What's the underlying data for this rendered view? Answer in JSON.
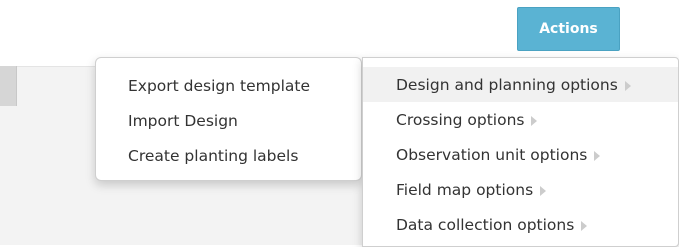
{
  "header": {
    "actions_label": "Actions"
  },
  "left_menu": {
    "items": [
      {
        "label": "Export design template"
      },
      {
        "label": "Import Design"
      },
      {
        "label": "Create planting labels"
      }
    ]
  },
  "right_menu": {
    "items": [
      {
        "label": "Design and planning options",
        "has_submenu": true,
        "active": true
      },
      {
        "label": "Crossing options",
        "has_submenu": true
      },
      {
        "label": "Observation unit options",
        "has_submenu": true
      },
      {
        "label": "Field map options",
        "has_submenu": true
      },
      {
        "label": "Data collection options",
        "has_submenu": true
      }
    ]
  },
  "colors": {
    "accent": "#5ab3d3",
    "panel_bg": "#f3f3f3",
    "active_item_bg": "#f1f1f1",
    "caret": "#cccccc"
  },
  "icons": {
    "submenu_caret": "caret-right-icon"
  }
}
